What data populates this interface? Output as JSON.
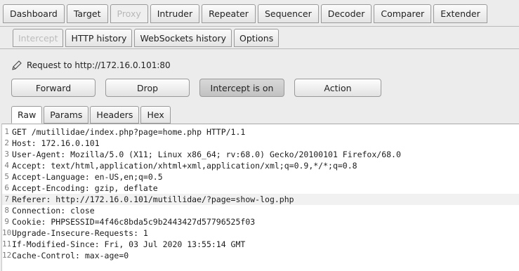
{
  "main_tabs": [
    "Dashboard",
    "Target",
    "Proxy",
    "Intruder",
    "Repeater",
    "Sequencer",
    "Decoder",
    "Comparer",
    "Extender"
  ],
  "sub_tabs": [
    "Intercept",
    "HTTP history",
    "WebSockets history",
    "Options"
  ],
  "request_label": "Request to http://172.16.0.101:80",
  "buttons": {
    "forward": "Forward",
    "drop": "Drop",
    "intercept": "Intercept is on",
    "action": "Action"
  },
  "view_tabs": [
    "Raw",
    "Params",
    "Headers",
    "Hex"
  ],
  "request_lines": [
    {
      "n": "1",
      "text": "GET /mutillidae/index.php?page=home.php HTTP/1.1"
    },
    {
      "n": "2",
      "text": "Host: 172.16.0.101"
    },
    {
      "n": "3",
      "text": "User-Agent: Mozilla/5.0 (X11; Linux x86_64; rv:68.0) Gecko/20100101 Firefox/68.0"
    },
    {
      "n": "4",
      "text": "Accept: text/html,application/xhtml+xml,application/xml;q=0.9,*/*;q=0.8"
    },
    {
      "n": "5",
      "text": "Accept-Language: en-US,en;q=0.5"
    },
    {
      "n": "6",
      "text": "Accept-Encoding: gzip, deflate"
    },
    {
      "n": "7",
      "text": "Referer: http://172.16.0.101/mutillidae/?page=show-log.php"
    },
    {
      "n": "8",
      "text": "Connection: close"
    },
    {
      "n": "9",
      "text": "Cookie: PHPSESSID=4f46c8bda5c9b2443427d57796525f03"
    },
    {
      "n": "10",
      "text": "Upgrade-Insecure-Requests: 1"
    },
    {
      "n": "11",
      "text": "If-Modified-Since: Fri, 03 Jul 2020 13:55:14 GMT"
    },
    {
      "n": "12",
      "text": "Cache-Control: max-age=0"
    }
  ]
}
